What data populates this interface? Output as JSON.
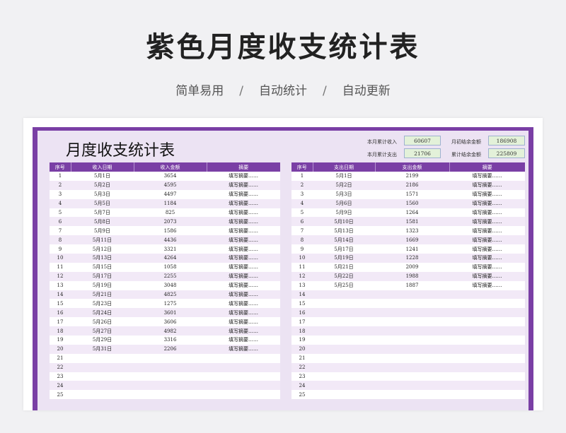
{
  "header": {
    "title": "紫色月度收支统计表",
    "features": [
      "简单易用",
      "自动统计",
      "自动更新"
    ],
    "separator": "/"
  },
  "sheet": {
    "title": "月度收支统计表",
    "stats": {
      "month_income_label": "本月累计收入",
      "month_income_value": "60607",
      "month_expense_label": "本月累计支出",
      "month_expense_value": "21706",
      "opening_balance_label": "月初结余金额",
      "opening_balance_value": "186908",
      "cumulative_balance_label": "累计结余金额",
      "cumulative_balance_value": "225809"
    },
    "income_table": {
      "headers": [
        "序号",
        "收入日期",
        "收入金额",
        "摘要"
      ],
      "rows": [
        [
          "1",
          "5月1日",
          "3654",
          "填写摘要……"
        ],
        [
          "2",
          "5月2日",
          "4595",
          "填写摘要……"
        ],
        [
          "3",
          "5月3日",
          "4497",
          "填写摘要……"
        ],
        [
          "4",
          "5月5日",
          "1184",
          "填写摘要……"
        ],
        [
          "5",
          "5月7日",
          "825",
          "填写摘要……"
        ],
        [
          "6",
          "5月8日",
          "2073",
          "填写摘要……"
        ],
        [
          "7",
          "5月9日",
          "1586",
          "填写摘要……"
        ],
        [
          "8",
          "5月11日",
          "4436",
          "填写摘要……"
        ],
        [
          "9",
          "5月12日",
          "3321",
          "填写摘要……"
        ],
        [
          "10",
          "5月13日",
          "4264",
          "填写摘要……"
        ],
        [
          "11",
          "5月15日",
          "1058",
          "填写摘要……"
        ],
        [
          "12",
          "5月17日",
          "2255",
          "填写摘要……"
        ],
        [
          "13",
          "5月19日",
          "3048",
          "填写摘要……"
        ],
        [
          "14",
          "5月21日",
          "4825",
          "填写摘要……"
        ],
        [
          "15",
          "5月23日",
          "1275",
          "填写摘要……"
        ],
        [
          "16",
          "5月24日",
          "3601",
          "填写摘要……"
        ],
        [
          "17",
          "5月26日",
          "3606",
          "填写摘要……"
        ],
        [
          "18",
          "5月27日",
          "4982",
          "填写摘要……"
        ],
        [
          "19",
          "5月29日",
          "3316",
          "填写摘要……"
        ],
        [
          "20",
          "5月31日",
          "2206",
          "填写摘要……"
        ],
        [
          "21",
          "",
          "",
          ""
        ],
        [
          "22",
          "",
          "",
          ""
        ],
        [
          "23",
          "",
          "",
          ""
        ],
        [
          "24",
          "",
          "",
          ""
        ],
        [
          "25",
          "",
          "",
          ""
        ]
      ]
    },
    "expense_table": {
      "headers": [
        "序号",
        "支出日期",
        "支出金额",
        "摘要"
      ],
      "rows": [
        [
          "1",
          "5月1日",
          "2199",
          "填写摘要……"
        ],
        [
          "2",
          "5月2日",
          "2186",
          "填写摘要……"
        ],
        [
          "3",
          "5月3日",
          "1571",
          "填写摘要……"
        ],
        [
          "4",
          "5月6日",
          "1560",
          "填写摘要……"
        ],
        [
          "5",
          "5月9日",
          "1264",
          "填写摘要……"
        ],
        [
          "6",
          "5月10日",
          "1581",
          "填写摘要……"
        ],
        [
          "7",
          "5月13日",
          "1323",
          "填写摘要……"
        ],
        [
          "8",
          "5月14日",
          "1669",
          "填写摘要……"
        ],
        [
          "9",
          "5月17日",
          "1241",
          "填写摘要……"
        ],
        [
          "10",
          "5月19日",
          "1228",
          "填写摘要……"
        ],
        [
          "11",
          "5月21日",
          "2009",
          "填写摘要……"
        ],
        [
          "12",
          "5月22日",
          "1988",
          "填写摘要……"
        ],
        [
          "13",
          "5月25日",
          "1887",
          "填写摘要……"
        ],
        [
          "14",
          "",
          "",
          ""
        ],
        [
          "15",
          "",
          "",
          ""
        ],
        [
          "16",
          "",
          "",
          ""
        ],
        [
          "17",
          "",
          "",
          ""
        ],
        [
          "18",
          "",
          "",
          ""
        ],
        [
          "19",
          "",
          "",
          ""
        ],
        [
          "20",
          "",
          "",
          ""
        ],
        [
          "21",
          "",
          "",
          ""
        ],
        [
          "22",
          "",
          "",
          ""
        ],
        [
          "23",
          "",
          "",
          ""
        ],
        [
          "24",
          "",
          "",
          ""
        ],
        [
          "25",
          "",
          "",
          ""
        ]
      ]
    }
  },
  "colors": {
    "accent": "#7a3fa5",
    "row_alt": "#f2e9f7",
    "stat_box": "#e3f1d9"
  }
}
